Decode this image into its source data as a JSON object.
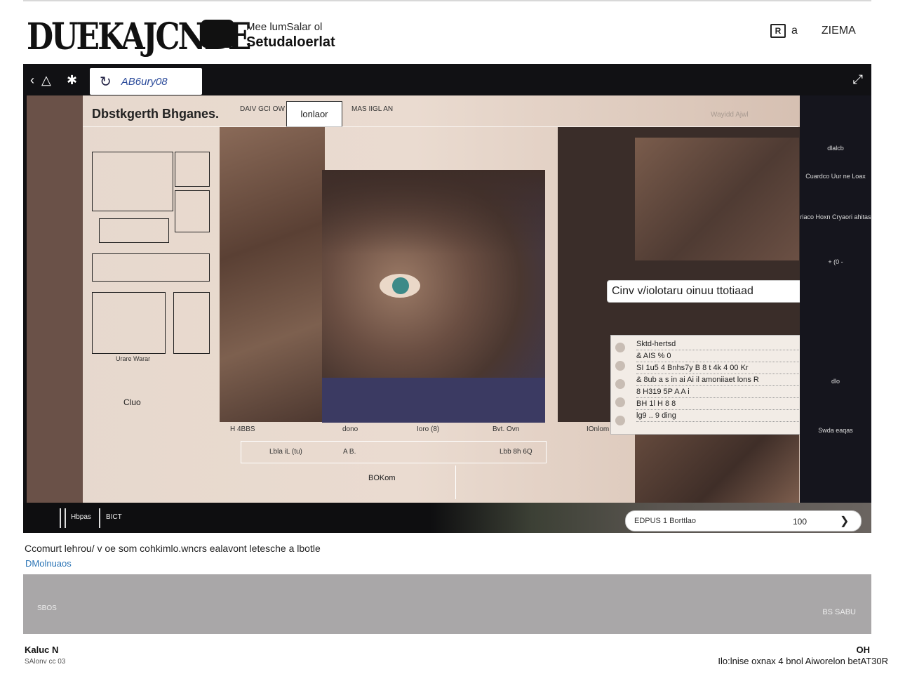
{
  "header": {
    "logo_text": "DUEKAJCNBE",
    "subtitle_small": "Mee lumSalar ol",
    "subtitle_bold": "Setudaloerlat",
    "user_initial": "R",
    "user_label": "a",
    "account_label": "ZIEMA"
  },
  "viewer": {
    "search_text": "AB6ury08",
    "canvas": {
      "title": "Dbstkgerth Bhganes.",
      "tab_left": "DAIV GCI OW",
      "tab_active": "lonlaor",
      "tab_right": "MAS IIGL AN",
      "faint_label": "Wayidd Ajwl",
      "sheet_note": "Urare Warar",
      "left_label": "Cluo"
    },
    "bar_labels": [
      "H 4BBS",
      "dono",
      "Ioro (8)",
      "Bvt. Ovn",
      "IOnlom"
    ],
    "mini_toolbar": [
      "Lbla iL (tu)",
      "A B.",
      "Lbb 8h 6Q"
    ],
    "zoom_label": "BOKom",
    "callout": "Cinv v/iolotaru oinuu ttotiaad",
    "note_lines": [
      "Sktd-hertsd",
      "& AIS % 0",
      "SI 1u5 4 Bnhs7y B 8 t 4k 4 00 Kr",
      "& 8ub a s in ai Ai il amoniiaet lons R",
      "8 H319 5P A A i",
      "BH 1l H 8 8",
      "lg9 .. 9 ding"
    ],
    "right_rail": [
      "dlalcb",
      "Cuardco Uur ne Loax",
      "riaco Hoxn Cryaori ahitas",
      "+ (0 -",
      "dlo",
      "Swda eaqas"
    ],
    "bottom_labels": [
      "Hbpas",
      "BICT"
    ],
    "counter": {
      "text": "EDPUS 1 Borttlao",
      "value": "100",
      "next_icon": "chevron-right-icon"
    }
  },
  "caption": "Ccomurt lehrou/ v oe som cohkimlo.wncrs ealavont letesche a lbotle",
  "caption_link": "DMolnuaos",
  "band": {
    "left": "SBOS",
    "right": "BS SABU"
  },
  "footer": {
    "left_title": "Kaluc N",
    "left_sub": "SAlonv cc 03",
    "right_title": "OH",
    "right_text": "Ilo:lnise oxnax 4 bnol Aiworelon betAT30R"
  }
}
